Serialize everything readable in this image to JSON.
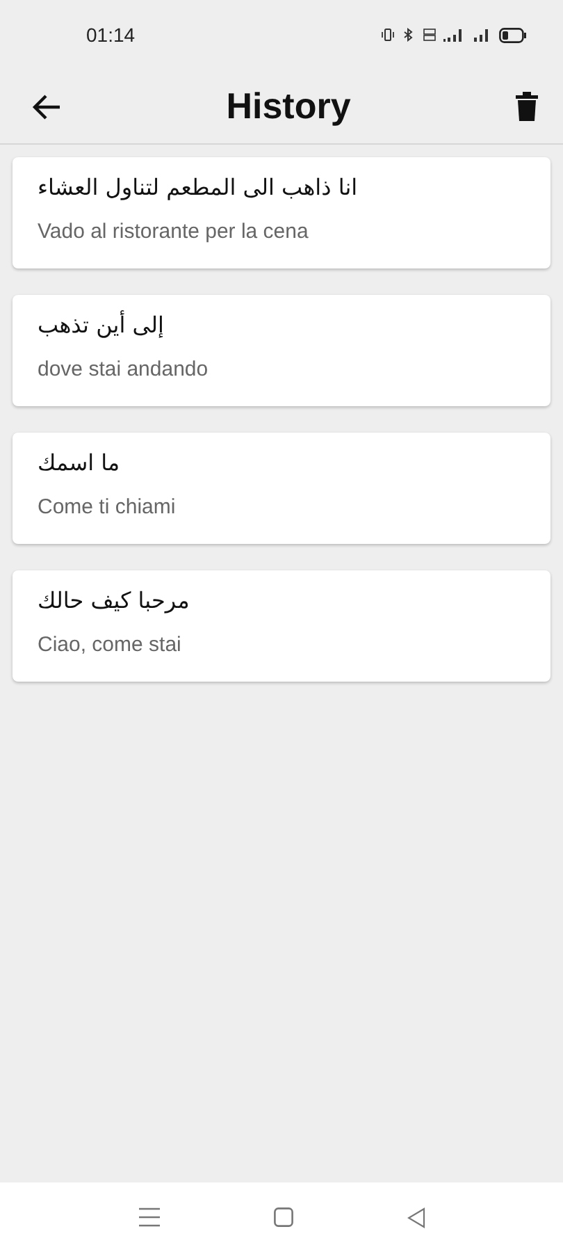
{
  "status_bar": {
    "time": "01:14"
  },
  "header": {
    "title": "History"
  },
  "entries": [
    {
      "source": "انا ذاهب الى المطعم لتناول العشاء",
      "translation": "Vado al ristorante per la cena"
    },
    {
      "source": "إلى أين تذهب",
      "translation": "dove stai andando"
    },
    {
      "source": "ما اسمك",
      "translation": "Come ti chiami"
    },
    {
      "source": "مرحبا كيف حالك",
      "translation": "Ciao, come stai"
    }
  ]
}
